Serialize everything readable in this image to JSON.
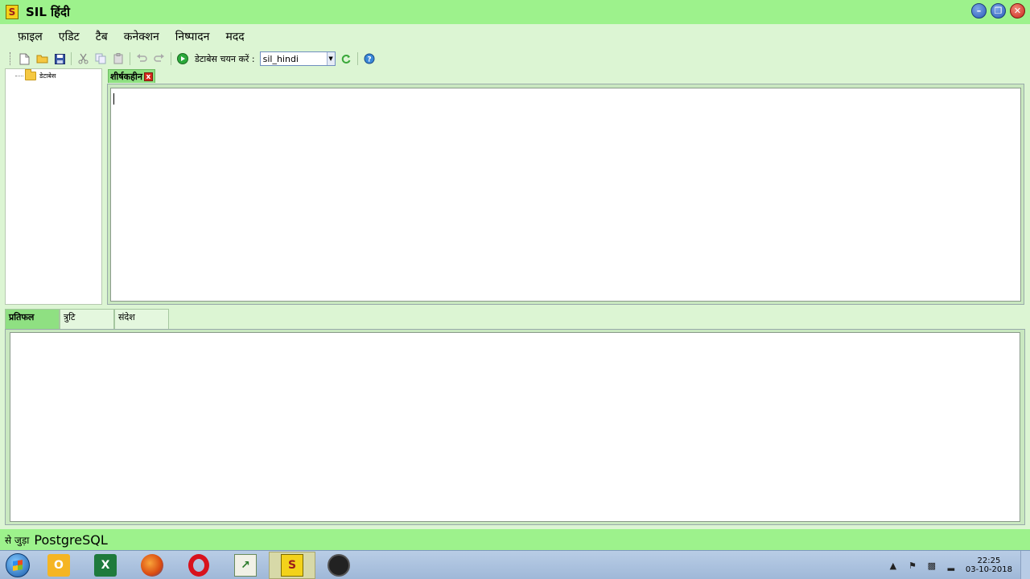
{
  "window": {
    "title": "SIL हिंदी",
    "app_icon_letter": "S"
  },
  "menu": {
    "items": [
      "फ़ाइल",
      "एडिट",
      "टैब",
      "कनेक्शन",
      "निष्पादन",
      "मदद"
    ]
  },
  "toolbar": {
    "select_db_label": "डेटाबेस चयन करें :",
    "db_selected": "sil_hindi"
  },
  "tree": {
    "root_label": "डेटाबेस"
  },
  "editor": {
    "tab_label": "शीर्षकहीन",
    "tab_close": "x"
  },
  "output": {
    "tabs": [
      "प्रतिफल",
      "त्रुटि",
      "संदेश"
    ],
    "active_tab": "प्रतिफल"
  },
  "status": {
    "prefix": "से जुड़ा",
    "db": "PostgreSQL"
  },
  "taskbar": {
    "clock_time": "22:25",
    "clock_date": "03-10-2018"
  },
  "colors": {
    "title_bar": "#9df28c",
    "menu_bg": "#dcf5d3",
    "active_tab": "#8fe082",
    "close_button": "#d42a1c"
  }
}
